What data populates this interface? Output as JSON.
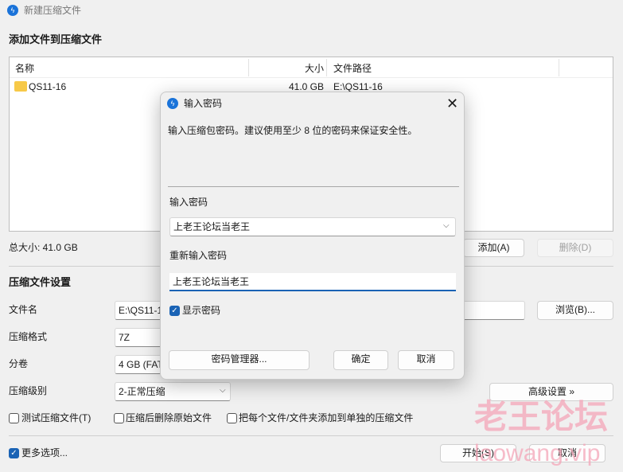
{
  "window": {
    "title": "新建压缩文件",
    "icon": "app-bolt-icon"
  },
  "files": {
    "heading": "添加文件到压缩文件",
    "columns": [
      "名称",
      "大小",
      "文件路径"
    ],
    "rows": [
      {
        "name": "QS11-16",
        "size": "41.0 GB",
        "path": "E:\\QS11-16",
        "icon": "folder-icon"
      }
    ],
    "total": "总大小: 41.0 GB",
    "add_label": "添加(A)",
    "delete_label": "删除(D)"
  },
  "settings": {
    "heading": "压缩文件设置",
    "filename_label": "文件名",
    "filename_value": "E:\\QS11-16",
    "browse_label": "浏览(B)...",
    "format_label": "压缩格式",
    "format_value": "7Z",
    "volume_label": "分卷",
    "volume_value": "4 GB (FAT",
    "level_label": "压缩级别",
    "level_value": "2-正常压缩",
    "advanced_label": "高级设置 »",
    "opt_test": "测试压缩文件(T)",
    "opt_delete": "压缩后删除原始文件",
    "opt_each": "把每个文件/文件夹添加到单独的压缩文件",
    "more_options": "更多选项...",
    "start_label": "开始(S)",
    "cancel_label": "取消"
  },
  "dialog": {
    "title": "输入密码",
    "description": "输入压缩包密码。建议使用至少 8 位的密码来保证安全性。",
    "password_label": "输入密码",
    "password_value": "上老王论坛当老王",
    "confirm_label": "重新输入密码",
    "confirm_value": "上老王论坛当老王",
    "show_password": "显示密码",
    "show_password_checked": true,
    "manager_label": "密码管理器...",
    "ok_label": "确定",
    "cancel_label": "取消"
  },
  "watermark": {
    "line1": "老王论坛",
    "line2": "laowang.vip",
    "color": "#f4a6b8"
  },
  "colors": {
    "accent": "#1a63b5"
  }
}
